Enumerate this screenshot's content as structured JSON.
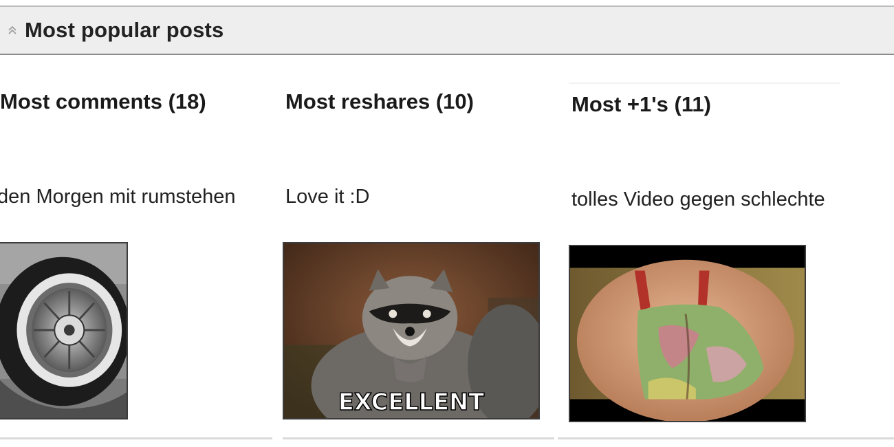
{
  "section": {
    "title": "Most popular posts",
    "collapse_icon": "double-chevron-up-icon"
  },
  "columns": [
    {
      "title": "Most comments (18)",
      "snippet": "den Morgen mit rumstehen",
      "thumbnail": "flat-tire-photo"
    },
    {
      "title": "Most reshares (10)",
      "snippet": "Love it :D",
      "thumbnail": "raccoon-meme-photo",
      "caption": "EXCELLENT"
    },
    {
      "title": "Most +1's (11)",
      "snippet": "tolles Video gegen schlechte",
      "thumbnail": "video-still-photo"
    }
  ],
  "colors": {
    "header_bg": "#eeeeee",
    "header_border": "#8c8c8c",
    "thumb_border": "#3c3c3c"
  }
}
